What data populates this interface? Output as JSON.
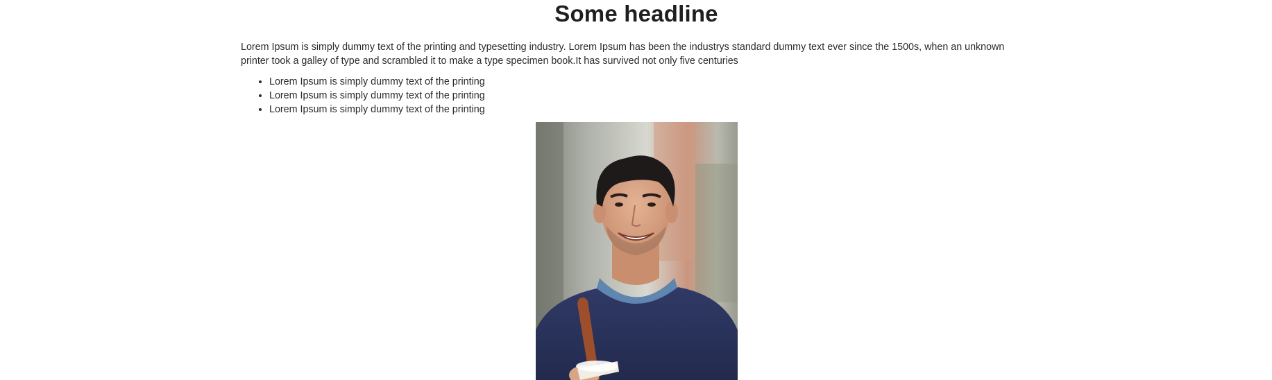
{
  "article": {
    "headline": "Some headline",
    "intro": "Lorem Ipsum is simply dummy text of the printing and typesetting industry. Lorem Ipsum has been the industrys standard dummy text ever since the 1500s, when an unknown printer took a galley of type and scrambled it to make a type specimen book.It has survived not only five centuries",
    "bullets": [
      "Lorem Ipsum is simply dummy text of the printing",
      "Lorem Ipsum is simply dummy text of the printing",
      "Lorem Ipsum is simply dummy text of the printing"
    ]
  },
  "photo": {
    "subject": "smiling-man-with-coffee",
    "colors": {
      "background_gray": "#b9bcb6",
      "background_warm": "#c8917b",
      "sweater": "#2a3258",
      "collar": "#5f86b0",
      "skin": "#d9a587",
      "hair": "#1e1a1a",
      "strap": "#9c4f2a"
    }
  }
}
